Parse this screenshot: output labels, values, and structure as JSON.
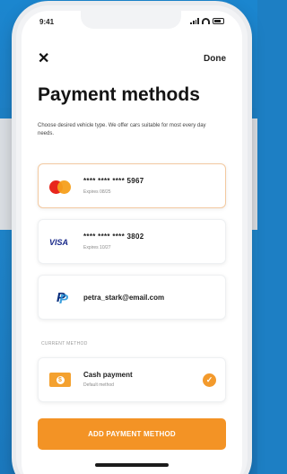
{
  "status_bar": {
    "time": "9:41"
  },
  "header": {
    "close_icon": "close-icon",
    "done_label": "Done",
    "title": "Payment methods",
    "subtitle": "Choose desired vehicle type. We offer cars suitable for most every day needs."
  },
  "payment_methods": [
    {
      "type": "mastercard",
      "logo_icon": "mastercard-logo",
      "number": "**** **** **** 5967",
      "expiry": "Expires 08/25",
      "selected": true
    },
    {
      "type": "visa",
      "logo_text": "VISA",
      "number": "**** **** **** 3802",
      "expiry": "Expires 10/27",
      "selected": false
    },
    {
      "type": "paypal",
      "logo_icon": "paypal-logo",
      "email": "petra_stark@email.com",
      "selected": false
    }
  ],
  "current_method": {
    "section_label": "CURRENT METHOD",
    "icon": "cash-icon",
    "icon_symbol": "$",
    "title": "Cash payment",
    "subtitle": "Default method",
    "check_icon": "check-icon"
  },
  "add_button": {
    "label": "ADD PAYMENT METHOD"
  },
  "colors": {
    "accent": "#f39325",
    "background_blue": "#1d7fc4",
    "selected_border": "#f3c9a0"
  }
}
